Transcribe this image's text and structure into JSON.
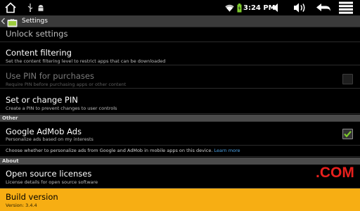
{
  "colors": {
    "highlight": "#f7ae13",
    "link": "#4ea3e6",
    "watermark": "#e8201d",
    "header_bg": "#4a4a4a",
    "checkbox_check": "#7ecb2c"
  },
  "statusbar": {
    "home_icon": "home-icon",
    "usb_icon": "usb-icon",
    "android_icon": "android-debug-icon",
    "wifi_icon": "wifi-icon",
    "battery_icon": "battery-charging-icon",
    "time": "3:24 PM",
    "volume_down_icon": "volume-down-icon",
    "volume_up_icon": "volume-up-icon",
    "back_icon": "back-icon",
    "menu_icon": "menu-icon"
  },
  "actionbar": {
    "title": "Settings"
  },
  "list": {
    "unlock": {
      "title": "Unlock settings"
    },
    "content_filtering": {
      "title": "Content filtering",
      "summary": "Set the content filtering level to restrict apps that can be downloaded"
    },
    "use_pin": {
      "title": "Use PIN for purchases",
      "summary": "Require PIN before purchasing apps or other content",
      "checked": false,
      "enabled": false
    },
    "set_pin": {
      "title": "Set or change PIN",
      "summary": "Create a PIN to prevent changes to user controls"
    },
    "other_header": "Other",
    "admob": {
      "title": "Google AdMob Ads",
      "summary": "Personalize ads based on my interests",
      "checked": true
    },
    "admob_info": {
      "text": "Choose whether to personalize ads from Google and AdMob in mobile apps on this device. ",
      "link": "Learn more"
    },
    "about_header": "About",
    "licenses": {
      "title": "Open source licenses",
      "summary": "License details for open source software"
    },
    "build": {
      "title": "Build version",
      "summary": "Version: 3.4.4"
    }
  },
  "watermark": ".COM"
}
